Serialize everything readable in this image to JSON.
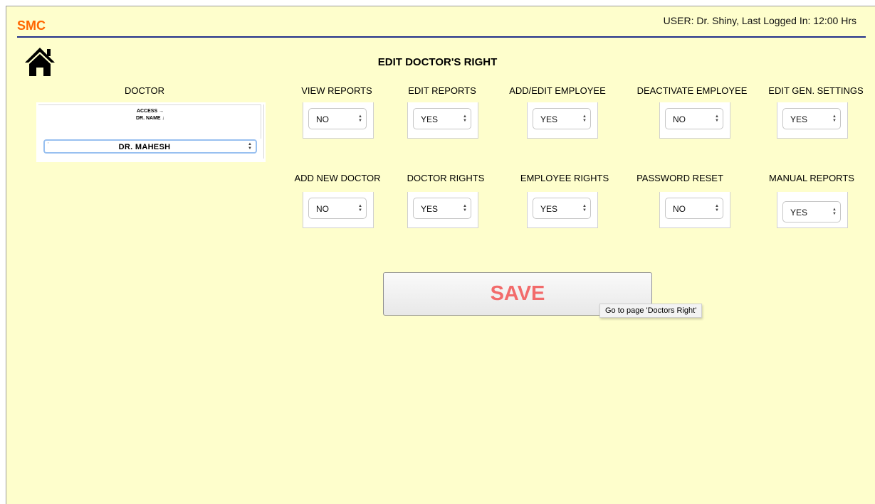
{
  "header": {
    "app_title": "SMC",
    "user_info": "USER: Dr. Shiny, Last Logged In: 12:00 Hrs"
  },
  "page_title": "EDIT DOCTOR'S RIGHT",
  "doctor": {
    "label": "DOCTOR",
    "access_header": "ACCESS →",
    "name_header": "DR. NAME ↓",
    "selected": "DR.  MAHESH"
  },
  "rights": [
    {
      "label": "VIEW REPORTS",
      "value": "NO"
    },
    {
      "label": "EDIT  REPORTS",
      "value": "YES"
    },
    {
      "label": "ADD/EDIT EMPLOYEE",
      "value": "YES"
    },
    {
      "label": "DEACTIVATE EMPLOYEE",
      "value": "NO"
    },
    {
      "label": "EDIT GEN. SETTINGS",
      "value": "YES"
    },
    {
      "label": "ADD NEW DOCTOR",
      "value": "NO"
    },
    {
      "label": "DOCTOR RIGHTS",
      "value": "YES"
    },
    {
      "label": "EMPLOYEE RIGHTS",
      "value": "YES"
    },
    {
      "label": "PASSWORD RESET",
      "value": "NO"
    },
    {
      "label": "MANUAL REPORTS",
      "value": "YES"
    }
  ],
  "save_label": "SAVE",
  "tooltip": "Go to page 'Doctors Right'",
  "icons": {
    "home": "home-icon",
    "select_arrows": "updown-arrows-icon"
  }
}
